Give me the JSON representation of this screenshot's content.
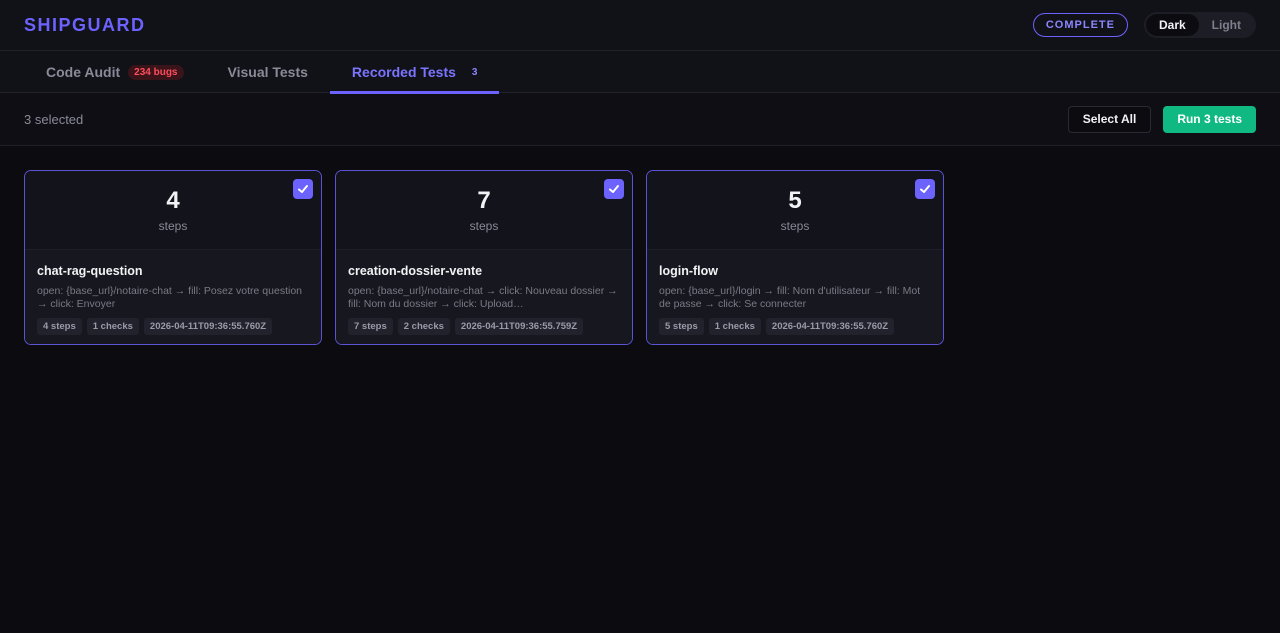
{
  "app": {
    "title": "SHIPGUARD",
    "status": "COMPLETE",
    "theme_dark": "Dark",
    "theme_light": "Light"
  },
  "tabs": [
    {
      "label": "Code Audit",
      "badge": "234 bugs"
    },
    {
      "label": "Visual Tests"
    },
    {
      "label": "Recorded Tests",
      "count": "3"
    }
  ],
  "toolbar": {
    "selected": "3 selected",
    "select_all": "Select All",
    "run": "Run 3 tests"
  },
  "cards": [
    {
      "steps_count": "4",
      "steps_label": "steps",
      "name": "chat-rag-question",
      "desc": "open: {base_url}/notaire-chat → fill: Posez votre question → click: Envoyer",
      "tags": [
        "4 steps",
        "1 checks",
        "2026-04-11T09:36:55.760Z"
      ]
    },
    {
      "steps_count": "7",
      "steps_label": "steps",
      "name": "creation-dossier-vente",
      "desc": "open: {base_url}/notaire-chat → click: Nouveau dossier → fill: Nom du dossier → click: Upload…",
      "tags": [
        "7 steps",
        "2 checks",
        "2026-04-11T09:36:55.759Z"
      ]
    },
    {
      "steps_count": "5",
      "steps_label": "steps",
      "name": "login-flow",
      "desc": "open: {base_url}/login → fill: Nom d'utilisateur → fill: Mot de passe → click: Se connecter",
      "tags": [
        "5 steps",
        "1 checks",
        "2026-04-11T09:36:55.760Z"
      ]
    }
  ],
  "colors": {
    "accent": "#6c63ff",
    "green": "#10b981",
    "danger": "#ff4d5e",
    "background": "#0b0b10"
  }
}
